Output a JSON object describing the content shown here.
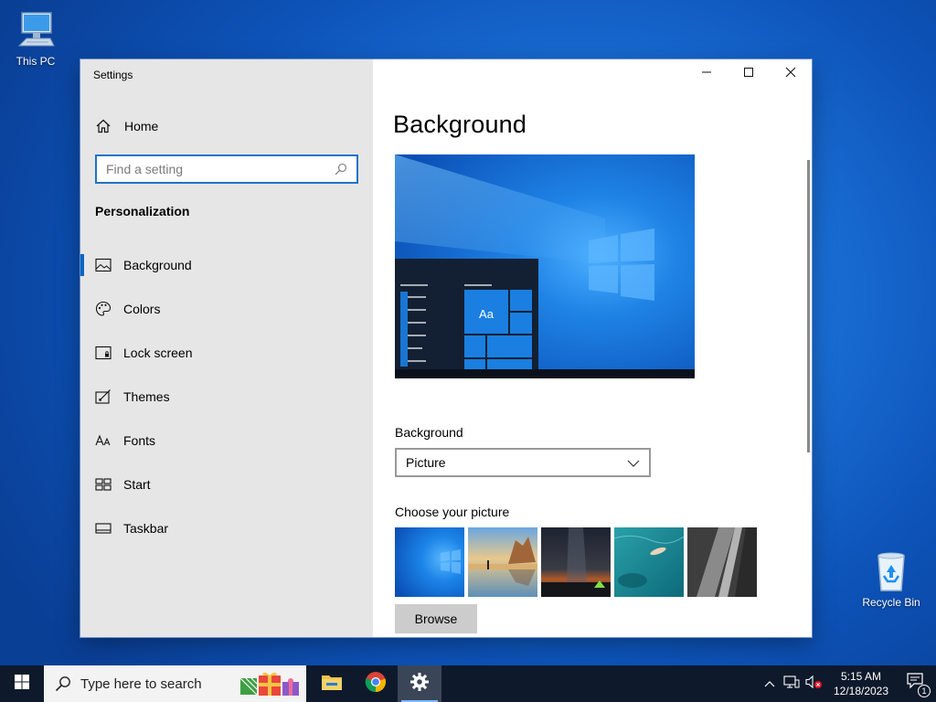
{
  "desktop": {
    "this_pc_label": "This PC",
    "recycle_bin_label": "Recycle Bin"
  },
  "window": {
    "title": "Settings",
    "controls": [
      "minimize-icon",
      "maximize-icon",
      "close-icon"
    ]
  },
  "sidebar": {
    "home_label": "Home",
    "search_placeholder": "Find a setting",
    "section_title": "Personalization",
    "items": [
      {
        "label": "Background",
        "icon": "picture-icon",
        "active": true
      },
      {
        "label": "Colors",
        "icon": "palette-icon",
        "active": false
      },
      {
        "label": "Lock screen",
        "icon": "lock-screen-icon",
        "active": false
      },
      {
        "label": "Themes",
        "icon": "themes-icon",
        "active": false
      },
      {
        "label": "Fonts",
        "icon": "fonts-icon",
        "active": false
      },
      {
        "label": "Start",
        "icon": "start-icon",
        "active": false
      },
      {
        "label": "Taskbar",
        "icon": "taskbar-icon",
        "active": false
      }
    ]
  },
  "main": {
    "page_title": "Background",
    "preview_tile_text": "Aa",
    "background_label": "Background",
    "background_value": "Picture",
    "choose_picture_label": "Choose your picture",
    "pictures": [
      "windows-blue-wallpaper",
      "beach-rocks-wallpaper",
      "night-sky-tent-wallpaper",
      "underwater-swimmer-wallpaper",
      "rock-cliff-wallpaper"
    ],
    "browse_label": "Browse"
  },
  "taskbar": {
    "search_placeholder": "Type here to search",
    "apps": [
      "file-explorer-icon",
      "chrome-icon",
      "settings-icon"
    ],
    "active_app": "settings-icon",
    "tray_icons": [
      "chevron-up-icon",
      "network-icon",
      "volume-muted-icon"
    ],
    "time": "5:15 AM",
    "date": "12/18/2023",
    "notification_count": "1"
  },
  "colors": {
    "accent": "#0a66c2",
    "taskbar": "#0e1a2b",
    "sidebar_bg": "#e6e6e6"
  }
}
